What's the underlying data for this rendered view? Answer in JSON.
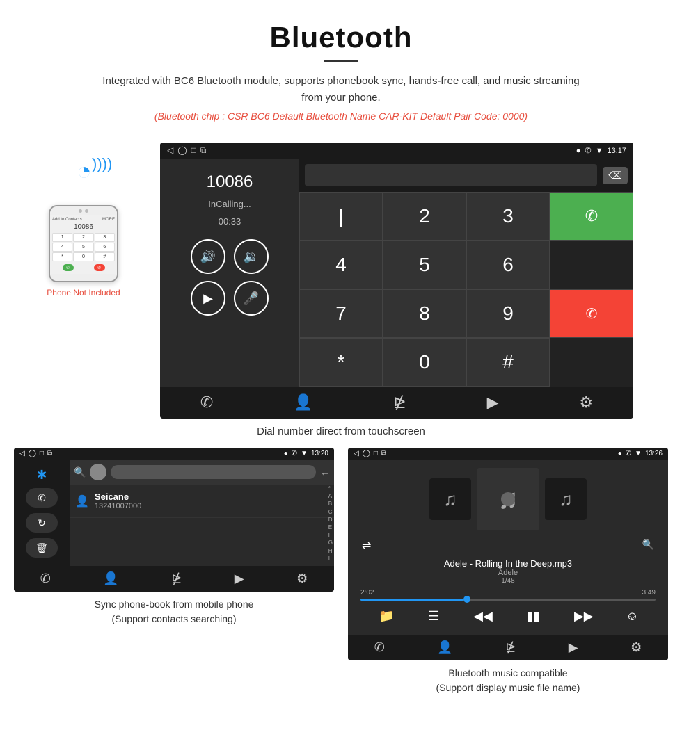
{
  "header": {
    "title": "Bluetooth",
    "description": "Integrated with BC6 Bluetooth module, supports phonebook sync, hands-free call, and music streaming from your phone.",
    "bluetooth_info": "(Bluetooth chip : CSR BC6    Default Bluetooth Name CAR-KIT    Default Pair Code: 0000)"
  },
  "phone_side": {
    "not_included": "Phone Not Included"
  },
  "main_call_screen": {
    "status_time": "13:17",
    "call_number": "10086",
    "call_status": "InCalling...",
    "call_timer": "00:33",
    "dialpad": [
      "1",
      "2",
      "3",
      "*",
      "4",
      "5",
      "6",
      "0",
      "7",
      "8",
      "9",
      "#"
    ]
  },
  "caption_main": "Dial number direct from touchscreen",
  "phonebook_screen": {
    "status_time": "13:20",
    "contact_name": "Seicane",
    "contact_number": "13241007000",
    "alphabet": [
      "*",
      "A",
      "B",
      "C",
      "D",
      "E",
      "F",
      "G",
      "H",
      "I"
    ]
  },
  "bottom_caption_left": "Sync phone-book from mobile phone\n(Support contacts searching)",
  "music_screen": {
    "status_time": "13:26",
    "song_title": "Adele - Rolling In the Deep.mp3",
    "song_artist": "Adele",
    "song_pages": "1/48",
    "current_time": "2:02",
    "total_time": "3:49"
  },
  "bottom_caption_right": "Bluetooth music compatible\n(Support display music file name)"
}
